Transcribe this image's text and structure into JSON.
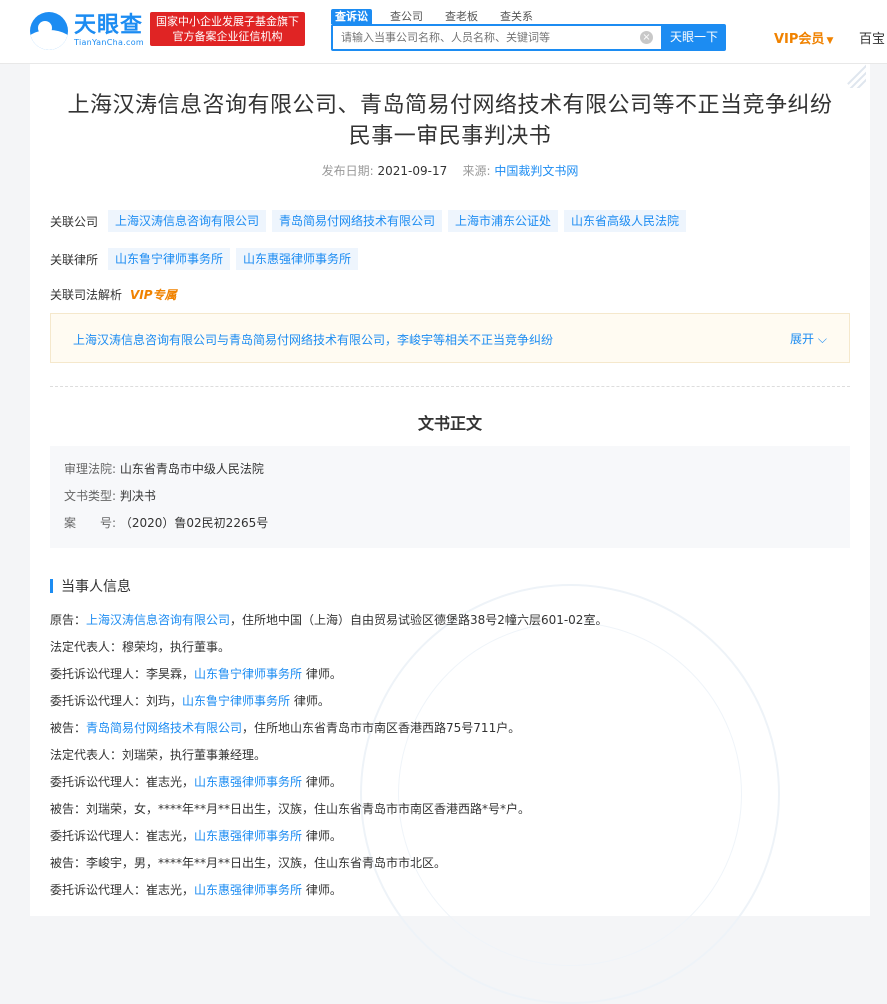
{
  "header": {
    "logo_cn": "天眼查",
    "logo_en": "TianYanCha.com",
    "badge_line1": "国家中小企业发展子基金旗下",
    "badge_line2": "官方备案企业征信机构",
    "search_tabs": [
      "查诉讼",
      "查公司",
      "查老板",
      "查关系"
    ],
    "search_placeholder": "请输入当事公司名称、人员名称、关键词等",
    "search_button": "天眼一下",
    "vip_label": "VIP会员",
    "baibao_label": "百宝"
  },
  "document": {
    "title_line1": "上海汉涛信息咨询有限公司、青岛简易付网络技术有限公司等不正当竞争纠纷",
    "title_line2": "民事一审民事判决书",
    "publish_label": "发布日期:",
    "publish_date": "2021-09-17",
    "source_label": "来源:",
    "source": "中国裁判文书网"
  },
  "related": {
    "companies_label": "关联公司",
    "companies": [
      "上海汉涛信息咨询有限公司",
      "青岛简易付网络技术有限公司",
      "上海市浦东公证处",
      "山东省高级人民法院"
    ],
    "lawyers_label": "关联律所",
    "lawyers": [
      "山东鲁宁律师事务所",
      "山东惠强律师事务所"
    ],
    "analysis_label": "关联司法解析",
    "vip_exclusive": "VIP专属",
    "analysis_link": "上海汉涛信息咨询有限公司与青岛简易付网络技术有限公司，李峻宇等相关不正当竞争纠纷",
    "expand": "展开"
  },
  "body": {
    "section_title": "文书正文",
    "court_label": "审理法院:",
    "court": "山东省青岛市中级人民法院",
    "type_label": "文书类型:",
    "type": "判决书",
    "case_label": "案　　号:",
    "case_no": "（2020）鲁02民初2265号",
    "parties_title": "当事人信息",
    "parties": [
      {
        "pre": "原告：",
        "link": "上海汉涛信息咨询有限公司",
        "post": "，住所地中国（上海）自由贸易试验区德堡路38号2幢六层601-02室。"
      },
      {
        "pre": "法定代表人：穆荣均，执行董事。",
        "link": "",
        "post": ""
      },
      {
        "pre": "委托诉讼代理人：李昊霖，",
        "link": "山东鲁宁律师事务所",
        "post": "律师。"
      },
      {
        "pre": "委托诉讼代理人：刘玙，",
        "link": "山东鲁宁律师事务所",
        "post": "律师。"
      },
      {
        "pre": "被告：",
        "link": "青岛简易付网络技术有限公司",
        "post": "，住所地山东省青岛市市南区香港西路75号711户。"
      },
      {
        "pre": "法定代表人：刘瑞荣，执行董事兼经理。",
        "link": "",
        "post": ""
      },
      {
        "pre": "委托诉讼代理人：崔志光，",
        "link": "山东惠强律师事务所",
        "post": "律师。"
      },
      {
        "pre": "被告：刘瑞荣，女，****年**月**日出生，汉族，住山东省青岛市市南区香港西路*号*户。",
        "link": "",
        "post": ""
      },
      {
        "pre": "委托诉讼代理人：崔志光，",
        "link": "山东惠强律师事务所",
        "post": "律师。"
      },
      {
        "pre": "被告：李峻宇，男，****年**月**日出生，汉族，住山东省青岛市市北区。",
        "link": "",
        "post": ""
      },
      {
        "pre": "委托诉讼代理人：崔志光，",
        "link": "山东惠强律师事务所",
        "post": "律师。"
      }
    ]
  }
}
